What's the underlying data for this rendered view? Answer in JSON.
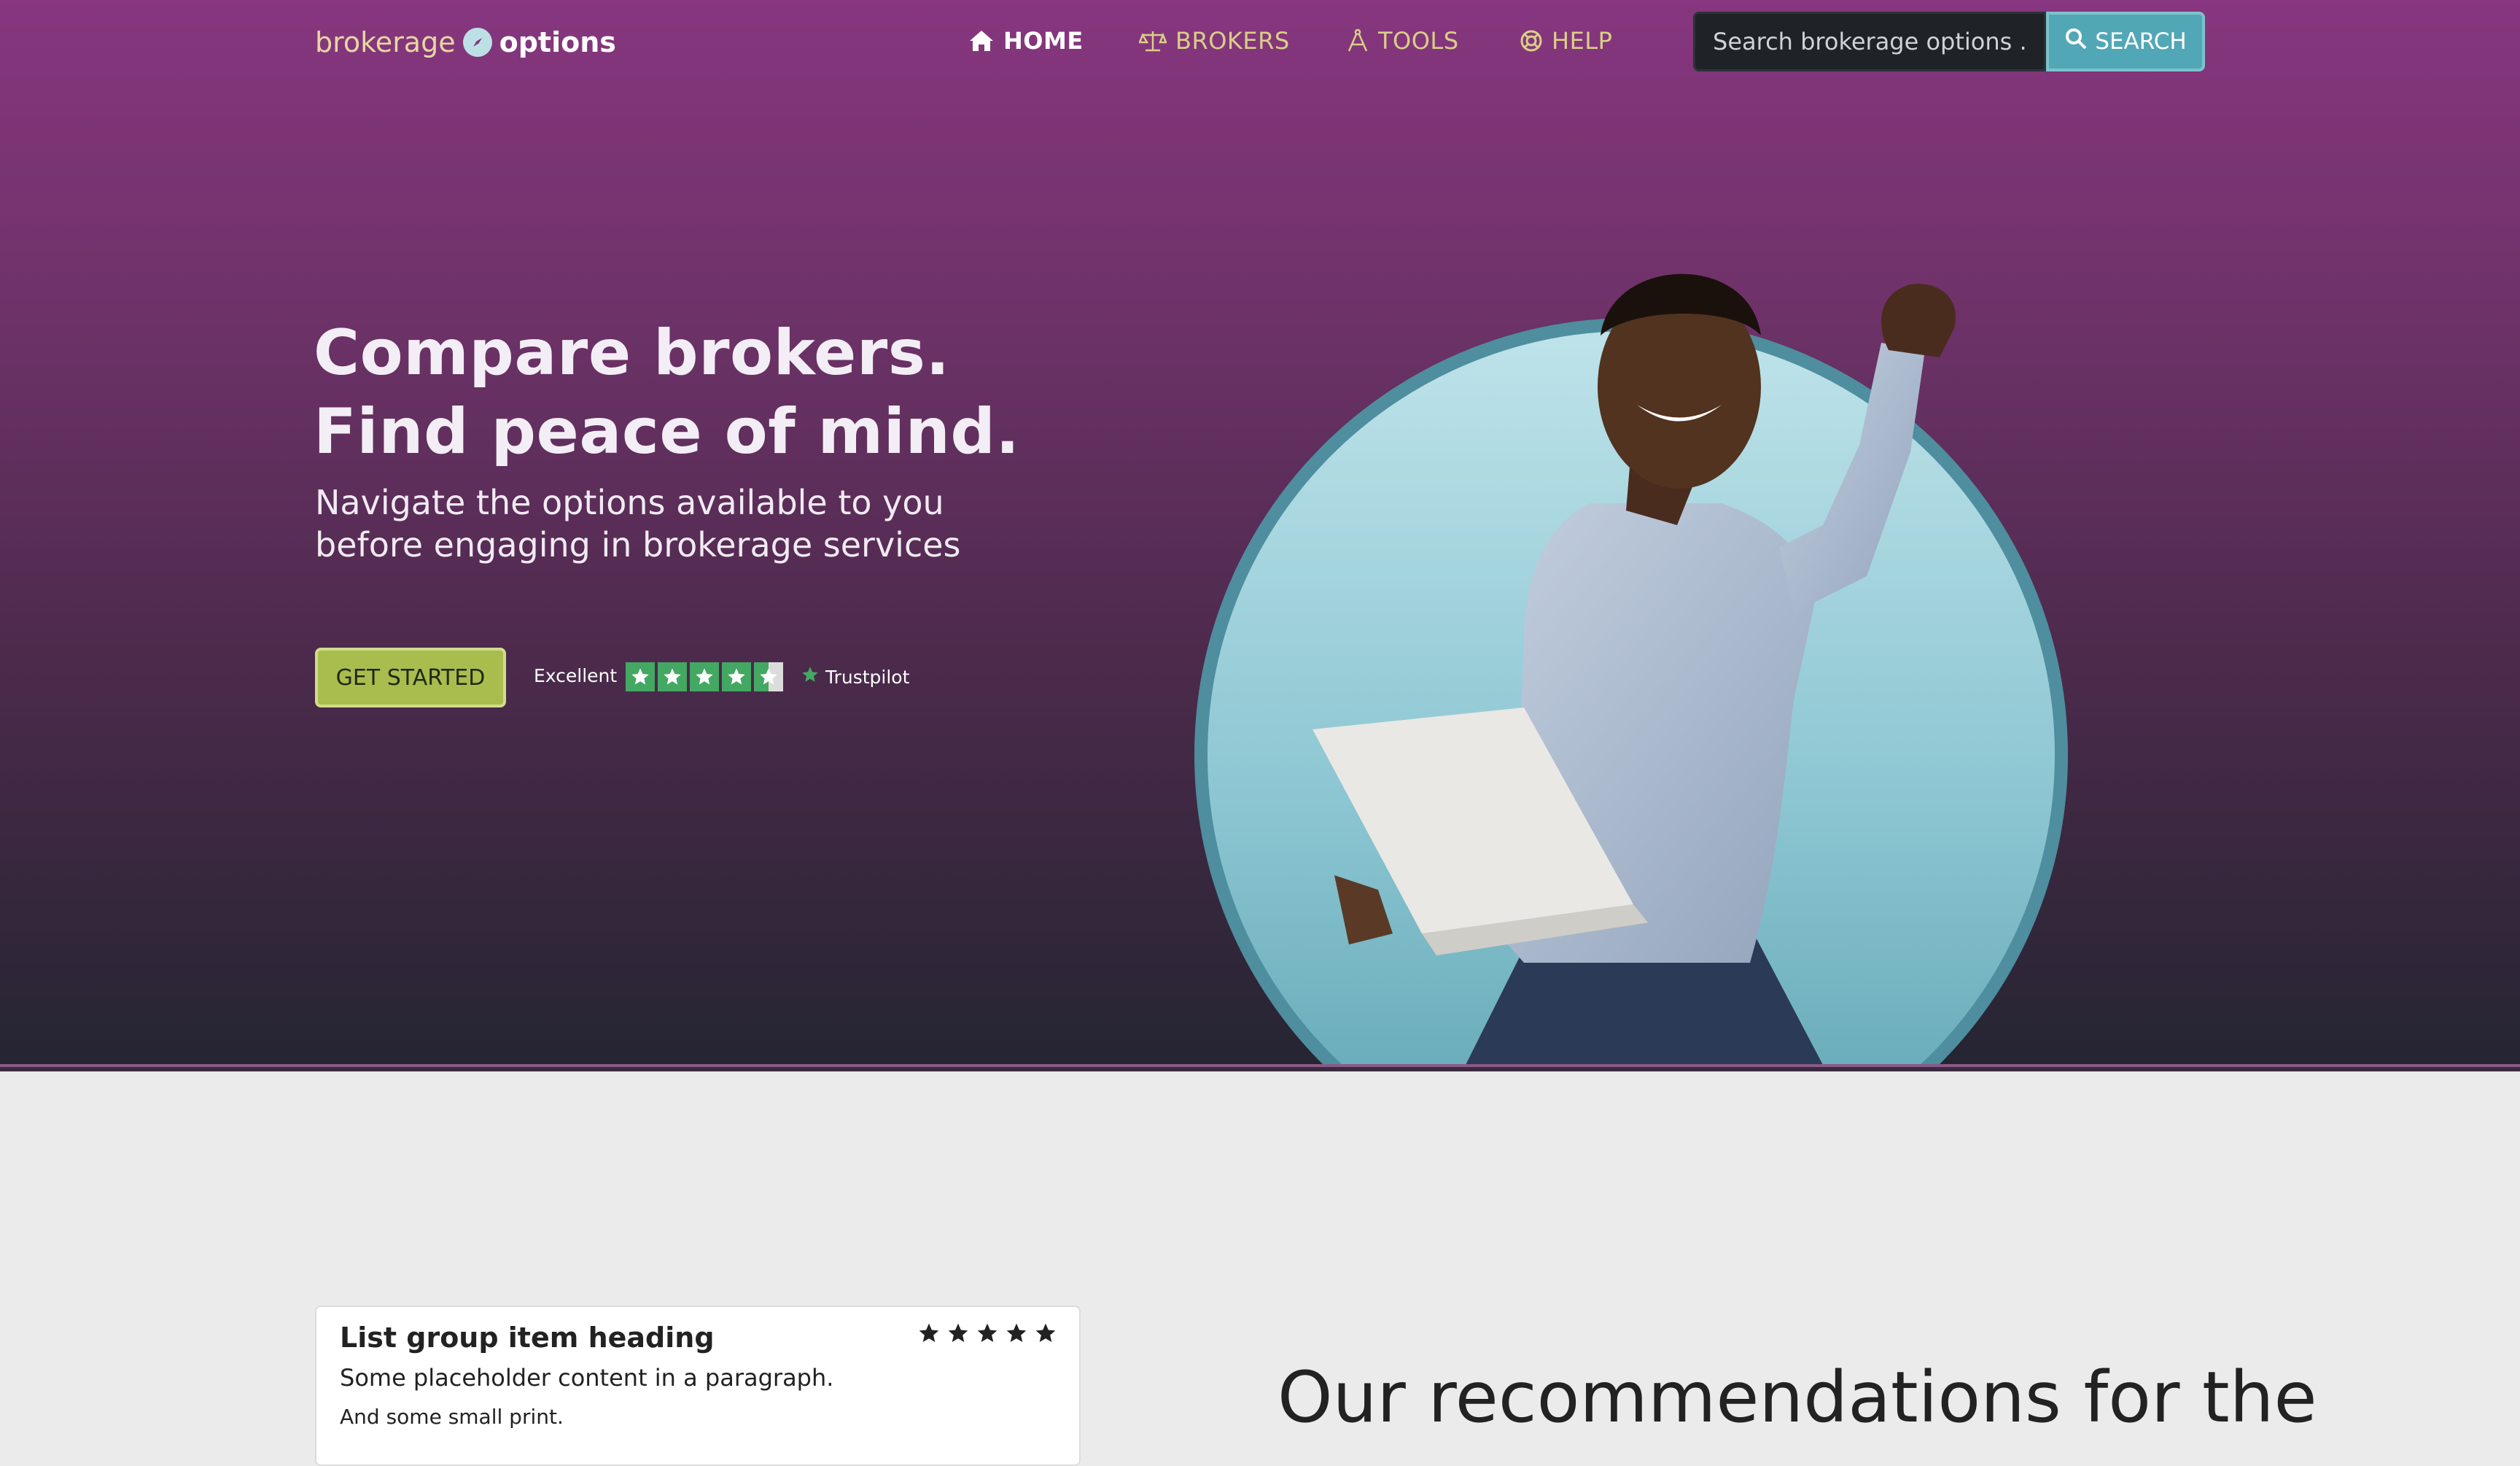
{
  "header": {
    "logo": {
      "part1": "brokerage",
      "part2": "options"
    },
    "nav": [
      {
        "label": "HOME",
        "icon": "home-icon",
        "active": true
      },
      {
        "label": "BROKERS",
        "icon": "scale-icon",
        "active": false
      },
      {
        "label": "TOOLS",
        "icon": "compass-tool-icon",
        "active": false
      },
      {
        "label": "HELP",
        "icon": "lifebuoy-icon",
        "active": false
      }
    ],
    "search": {
      "placeholder": "Search brokerage options ...",
      "value": "",
      "button_label": "SEARCH"
    }
  },
  "hero": {
    "title_line1": "Compare brokers.",
    "title_line2": "Find peace of mind.",
    "subtitle_line1": "Navigate the options available to you",
    "subtitle_line2": "before engaging in brokerage services",
    "cta_label": "GET STARTED",
    "trustpilot": {
      "rating_text": "Excellent",
      "stars": 4.5,
      "brand": "Trustpilot"
    }
  },
  "card": {
    "heading": "List group item heading",
    "stars": 5,
    "paragraph": "Some placeholder content in a paragraph.",
    "small": "And some small print."
  },
  "recommendations": {
    "heading": "Our recommendations for the"
  },
  "colors": {
    "hero_top": "#87367f",
    "hero_bottom": "#252532",
    "nav_text": "#d9cf87",
    "search_button": "#52a7b6",
    "cta": "#a9bd4f",
    "trustpilot_green": "#43a862",
    "page_bg": "#ebebeb"
  }
}
